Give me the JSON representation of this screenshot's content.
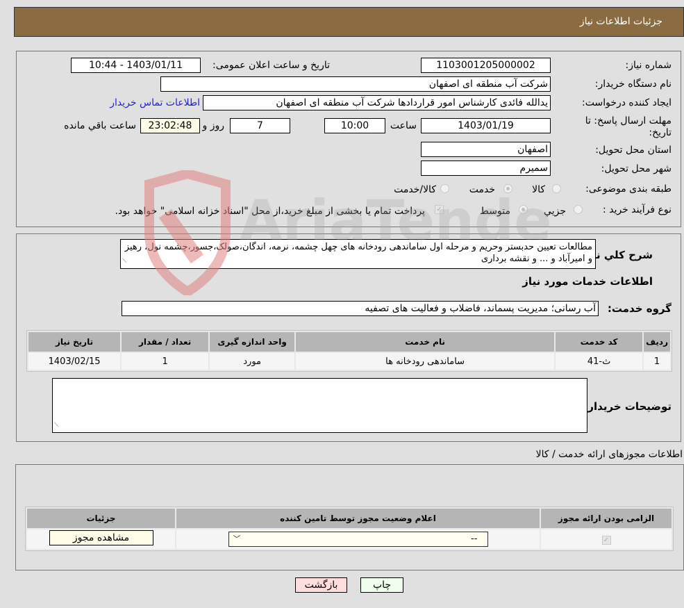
{
  "header": {
    "title": "جزئیات اطلاعات نیاز"
  },
  "form": {
    "need_number_label": "شماره نیاز:",
    "need_number": "1103001205000002",
    "announce_label": "تاریخ و ساعت اعلان عمومی:",
    "announce_value": "1403/01/11 - 10:44",
    "buyer_org_label": "نام دستگاه خریدار:",
    "buyer_org": "شرکت آب منطقه ای اصفهان",
    "requester_label": "ایجاد کننده درخواست:",
    "requester": "یدالله فائدی کارشناس امور قراردادها شرکت آب منطقه ای اصفهان",
    "buyer_contact_link": "اطلاعات تماس خریدار",
    "deadline_label": "مهلت ارسال پاسخ: تا تاریخ:",
    "deadline_date": "1403/01/19",
    "time_label": "ساعت",
    "deadline_time": "10:00",
    "days_value": "7",
    "days_label": "روز و",
    "remaining_time": "23:02:48",
    "remaining_label": "ساعت باقي مانده",
    "province_label": "استان محل تحویل:",
    "province": "اصفهان",
    "city_label": "شهر محل تحویل:",
    "city": "سمیرم",
    "category_label": "طبقه بندی موضوعی:",
    "category_options": [
      {
        "label": "کالا",
        "checked": false
      },
      {
        "label": "خدمت",
        "checked": true
      },
      {
        "label": "کالا/خدمت",
        "checked": false
      }
    ],
    "process_label": "نوع فرآیند خرید :",
    "process_options": [
      {
        "label": "جزيي",
        "checked": false
      },
      {
        "label": "متوسط",
        "checked": true
      }
    ],
    "treasury_note": "پرداخت تمام یا بخشی از مبلغ خرید،از محل \"اسناد خزانه اسلامی\" خواهد بود.",
    "treasury_checked": true
  },
  "description": {
    "label": "شرح کلي نیاز:",
    "text": "مطالعات تعیین حدبستر وحریم و مرحله اول ساماندهی رودخانه های چهل چشمه، نرمه، اندگان،صولک،جسور،چشمه نول، رهیز و امیرآباد و ... و نقشه برداری"
  },
  "services": {
    "section_title": "اطلاعات خدمات مورد نیاز",
    "group_label": "گروه خدمت:",
    "group_value": "آب رسانی؛ مدیریت پسماند، فاضلاب و فعالیت های تصفیه",
    "columns": [
      "ردیف",
      "کد خدمت",
      "نام خدمت",
      "واحد اندازه گیری",
      "تعداد / مقدار",
      "تاریخ نیاز"
    ],
    "rows": [
      [
        "1",
        "ث-41",
        "ساماندهی رودخانه ها",
        "مورد",
        "1",
        "1403/02/15"
      ]
    ]
  },
  "buyer_notes": {
    "label": "توضیحات خریدار:",
    "text": ""
  },
  "permits": {
    "section_title": "اطلاعات مجوزهای ارائه خدمت / کالا",
    "columns": [
      "الزامی بودن ارائه مجوز",
      "اعلام وضعیت مجوز توسط تامین کننده",
      "جزئیات"
    ],
    "rows": [
      {
        "required": true,
        "status": "--",
        "details_button": "مشاهده مجوز"
      }
    ]
  },
  "actions": {
    "print": "چاپ",
    "back": "بازگشت"
  },
  "watermark": {
    "text": "AriaTender.neT"
  },
  "colors": {
    "header_bg": "#8b6b41",
    "link": "#2222cc",
    "back_btn": "#ffdddd",
    "print_btn": "#eeffee"
  }
}
